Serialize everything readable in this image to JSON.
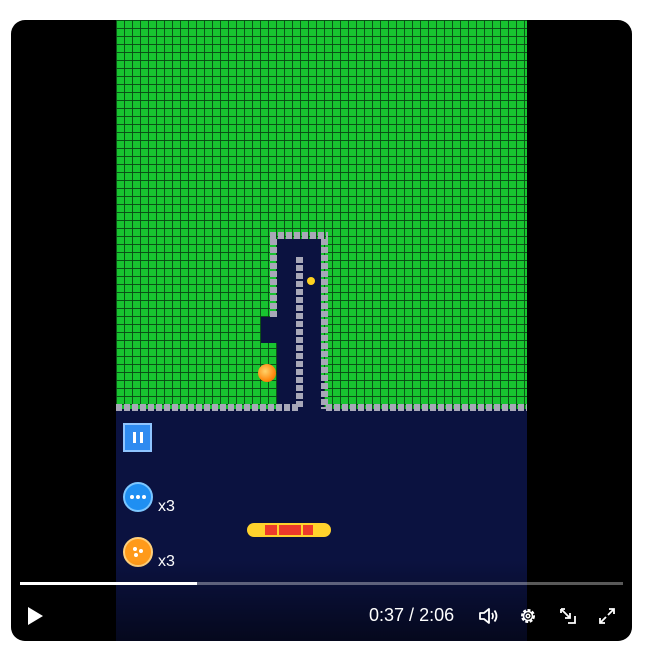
{
  "game": {
    "multiball_count": "x3",
    "fireball_count": "x3"
  },
  "player": {
    "current_time": "0:37",
    "time_separator": " / ",
    "duration": "2:06",
    "progress": 0.294
  },
  "icons": {
    "play": "play-icon",
    "volume": "volume-icon",
    "settings": "gear-icon",
    "miniplayer": "miniplayer-icon",
    "fullscreen": "fullscreen-icon",
    "pause_game": "pause-icon"
  },
  "colors": {
    "bricks": "#18c430",
    "game_background": "#0b1240",
    "paddle": "#ffd22c",
    "paddle_core": "#ee3a2a",
    "wall": "#a8a8b8"
  }
}
